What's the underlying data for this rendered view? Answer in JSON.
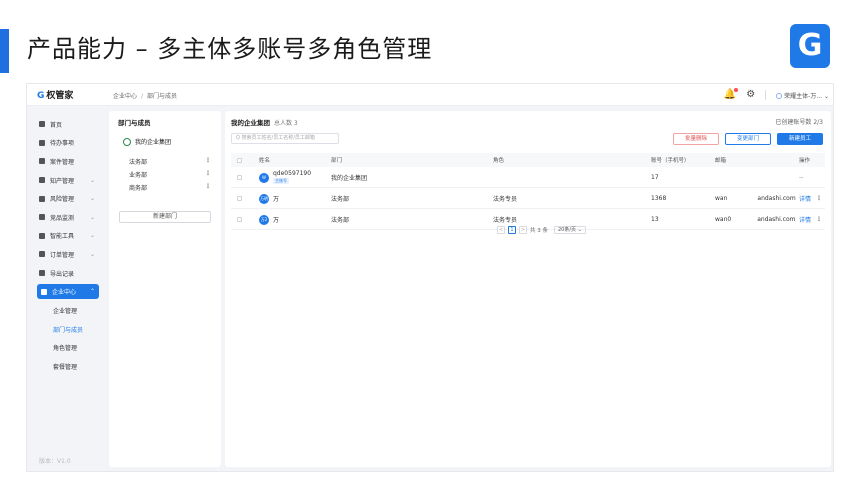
{
  "slide": {
    "title": "产品能力 – 多主体多账号多角色管理",
    "logo_glyph": "G",
    "accent": "#1f6fe0"
  },
  "app": {
    "name": "权管家",
    "logo_glyph": "G",
    "breadcrumb": [
      "企业中心",
      "部门与成员"
    ],
    "topbar": {
      "bell_icon": "♫",
      "settings_icon": "G",
      "user_label": "荣耀主体-万..."
    },
    "sidebar": {
      "items": [
        {
          "label": "首页",
          "icon": "home-icon"
        },
        {
          "label": "待办事项",
          "icon": "todo-icon"
        },
        {
          "label": "案件管理",
          "icon": "case-icon"
        },
        {
          "label": "知产管理",
          "icon": "ip-icon",
          "chevron": "⌄"
        },
        {
          "label": "风险管理",
          "icon": "shield-icon",
          "chevron": "⌄"
        },
        {
          "label": "竞品监测",
          "icon": "monitor-icon",
          "chevron": "⌄"
        },
        {
          "label": "智能工具",
          "icon": "tools-icon",
          "chevron": "⌄"
        },
        {
          "label": "订单管理",
          "icon": "order-icon",
          "chevron": "⌄"
        },
        {
          "label": "导出记录",
          "icon": "export-icon"
        }
      ],
      "active_group": {
        "label": "企业中心",
        "icon": "building-icon",
        "chevron": "⌃"
      },
      "sub_items": [
        {
          "label": "企业管理",
          "active": false
        },
        {
          "label": "部门与成员",
          "active": true
        },
        {
          "label": "角色管理",
          "active": false
        },
        {
          "label": "套餐管理",
          "active": false
        }
      ],
      "version": "版本：V1.0"
    },
    "dept_panel": {
      "title": "部门与成员",
      "group_name": "我的企业集团",
      "departments": [
        "法务部",
        "业务部",
        "商务部"
      ],
      "more_glyph": "⋮",
      "new_dept_button": "新建部门"
    },
    "members": {
      "title": "我的企业集团",
      "count_text": "总人数 3",
      "quota_text": "已创建账号数 2/3",
      "search_placeholder": "Q 搜索员工姓名/员工名称/员工邮箱",
      "buttons": {
        "batch_delete": "批量删除",
        "change_dept": "变更部门",
        "new_employee": "新建员工"
      },
      "columns": [
        "姓名",
        "部门",
        "角色",
        "账号（手机号）",
        "邮箱",
        "操作"
      ],
      "rows": [
        {
          "avatar": "W",
          "name": "qde0597190",
          "tag": "主账号",
          "dept": "我的企业集团",
          "role": "",
          "phone": "17",
          "email": "",
          "op": "--",
          "more": ""
        },
        {
          "avatar": "万明",
          "name": "万",
          "tag": "",
          "dept": "法务部",
          "role": "法务专员",
          "phone": "1368",
          "email": "wan",
          "email_tail": "andashi.com",
          "op": "详情",
          "more": "⋮"
        },
        {
          "avatar": "万2",
          "name": "万",
          "tag": "",
          "dept": "法务部",
          "role": "法务专员",
          "phone": "13",
          "email": "wan0",
          "email_tail": "andashi.com",
          "op": "详情",
          "more": "⋮"
        }
      ],
      "pager": {
        "prev": "<",
        "current": "1",
        "next": ">",
        "total": "共 3 条",
        "page_size": "20条/页 ⌄"
      }
    }
  }
}
